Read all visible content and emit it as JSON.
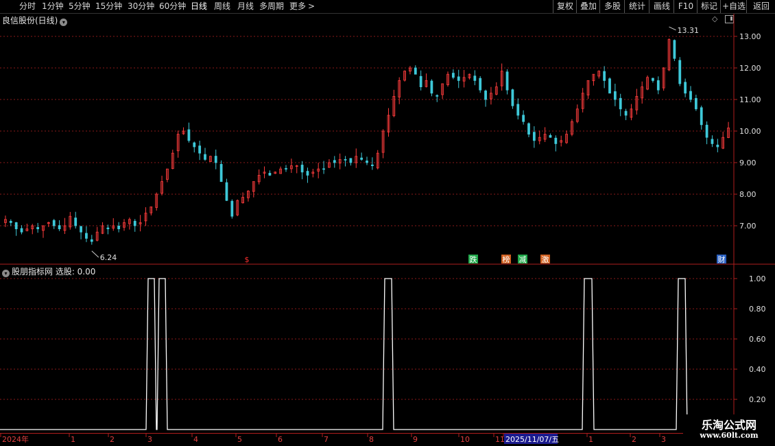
{
  "toolbar": {
    "periods": [
      "分时",
      "1分钟",
      "5分钟",
      "15分钟",
      "30分钟",
      "60分钟",
      "日线",
      "周线",
      "月线",
      "多周期",
      "更多"
    ],
    "more_arrow": ">",
    "active_period": "日线",
    "right_buttons": [
      "复权",
      "叠加",
      "多股",
      "统计",
      "画线",
      "F10",
      "标记",
      "+自选",
      "返回"
    ]
  },
  "main_chart": {
    "title": "良信股份(日线)",
    "high_marker": "13.31",
    "low_marker": "6.24",
    "y_ticks": [
      "13.00",
      "12.00",
      "11.00",
      "10.00",
      "9.00",
      "8.00",
      "7.00"
    ],
    "event_markers": [
      {
        "label": "$",
        "color": "#ff3030"
      },
      {
        "label": "跌",
        "color": "#1fa84a"
      },
      {
        "label": "榜",
        "color": "#d06020"
      },
      {
        "label": "减",
        "color": "#1fa84a"
      },
      {
        "label": "激",
        "color": "#d06020"
      },
      {
        "label": "财",
        "color": "#2a60c0"
      }
    ]
  },
  "indicator": {
    "title": "股朋指标网 选股: 0.00",
    "y_ticks": [
      "1.00",
      "0.80",
      "0.60",
      "0.40",
      "0.20"
    ]
  },
  "date_axis": {
    "labels": [
      "2024年",
      "1",
      "2",
      "3",
      "4",
      "5",
      "6",
      "7",
      "8",
      "9",
      "10",
      "11",
      "2025/11/07/五",
      "1",
      "2",
      "3"
    ]
  },
  "watermark": {
    "title": "乐淘公式网",
    "url": "www.60lt.com"
  },
  "colors": {
    "up": "#ff3c3c",
    "down": "#3ec8d8",
    "grid": "#8b1a1a",
    "axis": "#b01e1e",
    "signal": "#ffffff"
  },
  "chart_data": {
    "type": "candlestick",
    "ylim": [
      6.0,
      13.5
    ],
    "y_ticks": [
      7,
      8,
      9,
      10,
      11,
      12,
      13
    ],
    "closes": [
      7.2,
      7.1,
      6.9,
      6.8,
      6.9,
      7.0,
      6.9,
      7.0,
      7.1,
      7.0,
      6.9,
      7.0,
      7.3,
      7.0,
      6.8,
      6.6,
      6.5,
      6.8,
      7.0,
      6.9,
      7.0,
      6.9,
      7.1,
      7.2,
      7.0,
      7.1,
      7.4,
      7.6,
      8.0,
      8.4,
      8.8,
      9.3,
      9.9,
      10.0,
      9.7,
      9.5,
      9.3,
      9.1,
      9.2,
      9.0,
      8.4,
      7.8,
      7.3,
      7.8,
      7.9,
      8.1,
      8.4,
      8.6,
      8.7,
      8.6,
      8.7,
      8.8,
      8.8,
      8.9,
      8.9,
      8.7,
      8.6,
      8.7,
      8.8,
      8.8,
      9.0,
      9.0,
      9.1,
      9.1,
      9.0,
      9.2,
      9.1,
      9.0,
      8.9,
      9.3,
      10.0,
      10.5,
      11.1,
      11.6,
      11.9,
      12.0,
      11.8,
      11.4,
      11.6,
      11.2,
      11.1,
      11.5,
      11.8,
      11.7,
      11.6,
      11.7,
      11.8,
      11.6,
      11.3,
      11.0,
      11.2,
      11.4,
      11.9,
      11.3,
      10.8,
      10.5,
      10.3,
      9.9,
      9.7,
      9.8,
      9.9,
      9.8,
      9.6,
      9.7,
      9.9,
      10.3,
      10.7,
      11.2,
      11.6,
      11.8,
      11.9,
      11.6,
      11.2,
      11.0,
      10.7,
      10.5,
      10.7,
      11.1,
      11.4,
      11.7,
      11.6,
      11.3,
      12.0,
      12.9,
      12.3,
      11.5,
      11.2,
      11.0,
      10.7,
      10.2,
      9.8,
      9.6,
      9.5,
      9.8,
      10.1
    ]
  }
}
